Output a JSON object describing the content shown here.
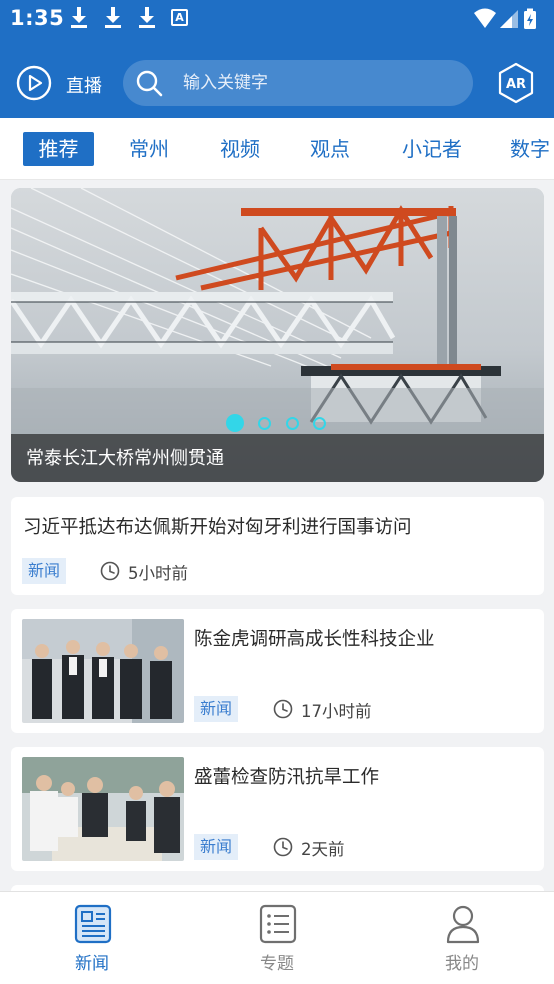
{
  "status_bar": {
    "time": "1:35",
    "notification_icons": [
      "download-icon",
      "download-icon",
      "download-icon",
      "app-a-icon"
    ],
    "system_icons": [
      "wifi-icon",
      "signal-icon",
      "battery-charging-icon"
    ],
    "app_badge_letter": "A"
  },
  "header": {
    "live_label": "直播",
    "search_placeholder": "输入关键字",
    "ar_label": "AR"
  },
  "tabs": [
    {
      "label": "推荐",
      "active": true
    },
    {
      "label": "常州",
      "active": false
    },
    {
      "label": "视频",
      "active": false
    },
    {
      "label": "观点",
      "active": false
    },
    {
      "label": "小记者",
      "active": false
    },
    {
      "label": "数字",
      "active": false
    }
  ],
  "banner": {
    "caption": "常泰长江大桥常州侧贯通",
    "slide_count": 4,
    "active_slide": 1
  },
  "news": [
    {
      "title": "习近平抵达布达佩斯开始对匈牙利进行国事访问",
      "tag": "新闻",
      "time": "5小时前",
      "has_thumb": false
    },
    {
      "title": "陈金虎调研高成长性科技企业",
      "tag": "新闻",
      "time": "17小时前",
      "has_thumb": true
    },
    {
      "title": "盛蕾检查防汛抗旱工作",
      "tag": "新闻",
      "time": "2天前",
      "has_thumb": true
    }
  ],
  "bottom_nav": [
    {
      "label": "新闻",
      "icon": "newspaper-icon",
      "active": true
    },
    {
      "label": "专题",
      "icon": "list-icon",
      "active": false
    },
    {
      "label": "我的",
      "icon": "person-icon",
      "active": false
    }
  ],
  "colors": {
    "brand": "#1f6fc5",
    "accent_dot": "#33d6e8",
    "tag_bg": "#e4eef9"
  }
}
